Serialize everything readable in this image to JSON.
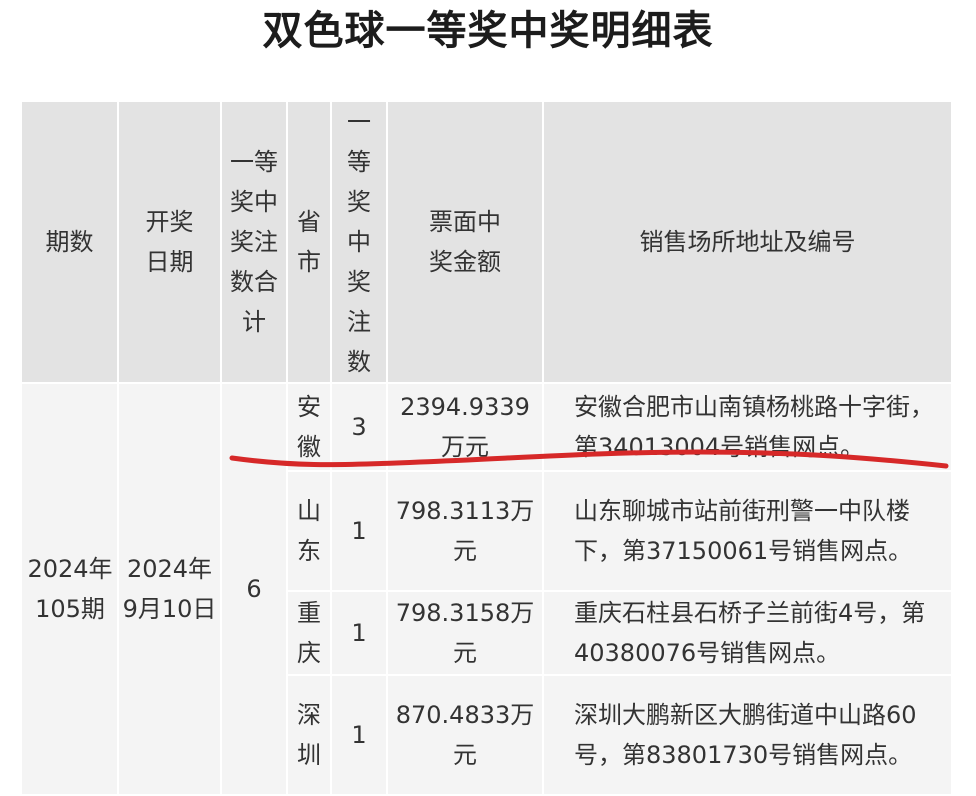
{
  "title": "双色球一等奖中奖明细表",
  "headers": {
    "period": "期数",
    "draw_date": "开奖日期",
    "total_winners": "一等奖中奖注数合计",
    "province": "省市",
    "winners": "一等奖中奖注数",
    "amount": "票面中奖金额",
    "address": "销售场所地址及编号"
  },
  "group": {
    "period": "2024年105期",
    "draw_date": "2024年9月10日",
    "total_winners": "6"
  },
  "rows": [
    {
      "province": "安徽",
      "winners": "3",
      "amount": "2394.9339万元",
      "address": "安徽合肥市山南镇杨桃路十字街，第34013004号销售网点。"
    },
    {
      "province": "山东",
      "winners": "1",
      "amount": "798.3113万元",
      "address": "山东聊城市站前街刑警一中队楼下，第37150061号销售网点。"
    },
    {
      "province": "重庆",
      "winners": "1",
      "amount": "798.3158万元",
      "address": "重庆石柱县石桥子兰前街4号，第40380076号销售网点。"
    },
    {
      "province": "深圳",
      "winners": "1",
      "amount": "870.4833万元",
      "address": "深圳大鹏新区大鹏街道中山路60号，第83801730号销售网点。"
    }
  ],
  "annotation_color": "#d62828"
}
